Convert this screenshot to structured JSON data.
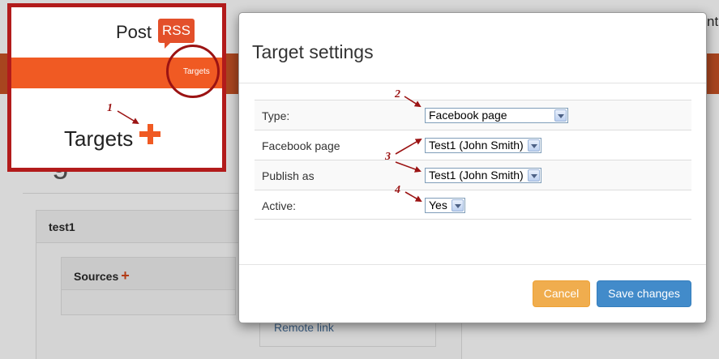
{
  "background": {
    "heading_fragment": "g",
    "right_text_fragment": "nt",
    "panel_title": "test1",
    "sources_label": "Sources",
    "sources_plus": "+",
    "remote_link": "Remote link"
  },
  "modal": {
    "title": "Target settings",
    "fields": [
      {
        "label": "Type:",
        "value": "Facebook page"
      },
      {
        "label": "Facebook page",
        "value": "Test1 (John Smith)"
      },
      {
        "label": "Publish as",
        "value": "Test1 (John Smith)"
      },
      {
        "label": "Active:",
        "value": "Yes"
      }
    ],
    "cancel_label": "Cancel",
    "save_label": "Save changes"
  },
  "inset": {
    "logo_text": "Post",
    "logo_badge": "RSS",
    "nav_label": "Targets",
    "targets_label": "Targets"
  },
  "annotations": {
    "n1": "1",
    "n2": "2",
    "n3": "3",
    "n4": "4"
  },
  "colors": {
    "brand_orange": "#f05a23",
    "annotation_red": "#9b1313",
    "cancel_button": "#f0ad4e",
    "save_button": "#428bca"
  }
}
